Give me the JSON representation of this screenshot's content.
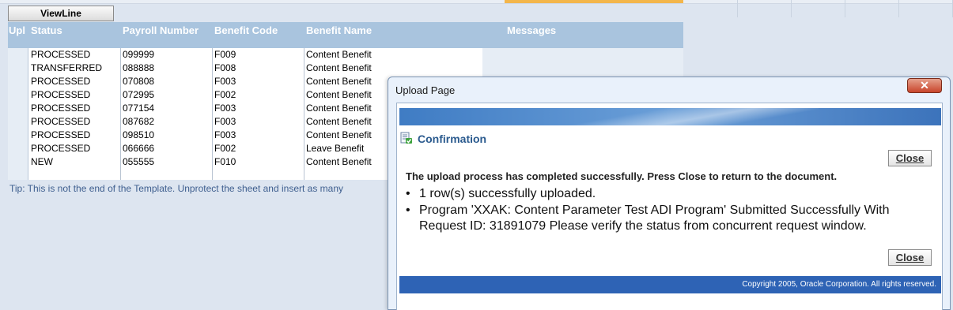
{
  "toolbar": {
    "viewline_label": "ViewLine"
  },
  "table": {
    "headers": [
      "Upl",
      "Status",
      "Payroll Number",
      "Benefit Code",
      "Benefit Name",
      "Messages"
    ],
    "rows": [
      {
        "status": "PROCESSED",
        "payroll": "099999",
        "code": "F009",
        "name": "Content Benefit"
      },
      {
        "status": "TRANSFERRED",
        "payroll": "088888",
        "code": "F008",
        "name": "Content Benefit"
      },
      {
        "status": "PROCESSED",
        "payroll": "070808",
        "code": "F003",
        "name": "Content Benefit"
      },
      {
        "status": "PROCESSED",
        "payroll": "072995",
        "code": "F002",
        "name": "Content Benefit"
      },
      {
        "status": "PROCESSED",
        "payroll": "077154",
        "code": "F003",
        "name": "Content Benefit"
      },
      {
        "status": "PROCESSED",
        "payroll": "087682",
        "code": "F003",
        "name": "Content Benefit"
      },
      {
        "status": "PROCESSED",
        "payroll": "098510",
        "code": "F003",
        "name": "Content Benefit"
      },
      {
        "status": "PROCESSED",
        "payroll": "066666",
        "code": "F002",
        "name": "Leave Benefit"
      },
      {
        "status": "NEW",
        "payroll": "055555",
        "code": "F010",
        "name": "Content Benefit"
      }
    ],
    "tip": "Tip: This is not the end of the Template.  Unprotect the sheet and insert as many"
  },
  "dialog": {
    "title": "Upload Page",
    "close_glyph": "✕",
    "heading": "Confirmation",
    "close_label": "Close",
    "message": "The upload process has completed successfully. Press Close to return to the document.",
    "bullets": [
      "1 row(s) successfully uploaded.",
      "Program 'XXAK: Content Parameter Test ADI Program' Submitted Successfully With",
      "Request ID: 31891079 Please verify the status from concurrent request window."
    ],
    "bullet_char": "•",
    "footer": "Copyright 2005, Oracle Corporation. All rights reserved."
  },
  "colors": {
    "header_bg": "#a9c4de",
    "dialog_banner": "#3f7cc4",
    "footer_bar": "#2e63b5",
    "confirmation_text": "#2a5a8e"
  }
}
